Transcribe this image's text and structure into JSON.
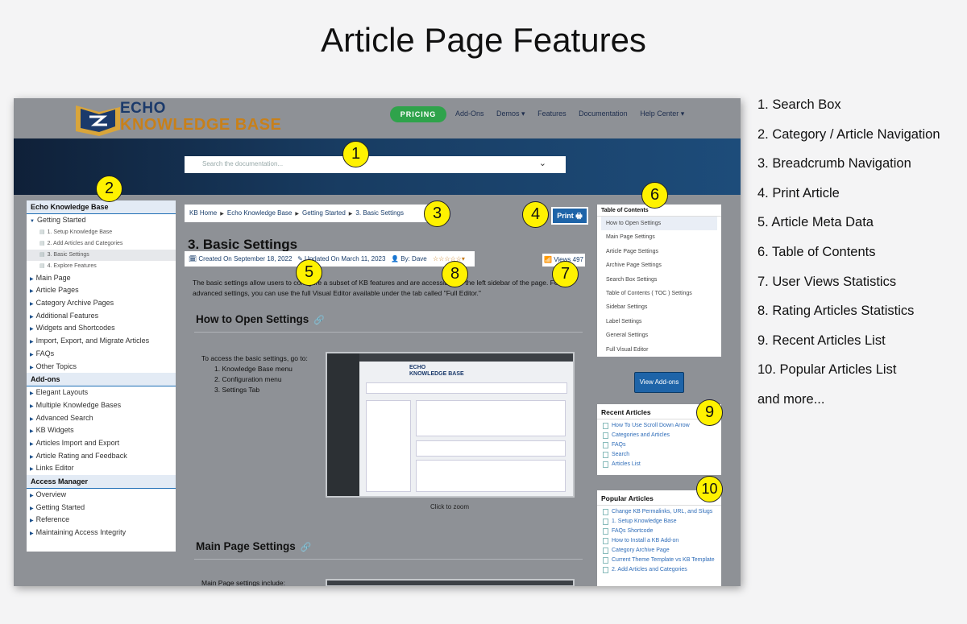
{
  "page_title": "Article Page Features",
  "site": {
    "logo_line1": "ECHO",
    "logo_line2": "KNOWLEDGE BASE",
    "pricing_label": "PRICING",
    "nav": [
      "Add-Ons",
      "Demos ▾",
      "Features",
      "Documentation",
      "Help Center ▾"
    ],
    "search_placeholder": "Search the documentation...",
    "search_chevron": "⌄"
  },
  "sidebar": {
    "title": "Echo Knowledge Base",
    "getting_started": "Getting Started",
    "sub_items": [
      "1. Setup Knowledge Base",
      "2. Add Articles and Categories",
      "3. Basic Settings",
      "4. Explore Features"
    ],
    "items": [
      "Main Page",
      "Article Pages",
      "Category Archive Pages",
      "Additional Features",
      "Widgets and Shortcodes",
      "Import, Export, and Migrate Articles",
      "FAQs",
      "Other Topics"
    ],
    "addons_title": "Add-ons",
    "addons": [
      "Elegant Layouts",
      "Multiple Knowledge Bases",
      "Advanced Search",
      "KB Widgets",
      "Articles Import and Export",
      "Article Rating and Feedback",
      "Links Editor"
    ],
    "access_title": "Access Manager",
    "access": [
      "Overview",
      "Getting Started",
      "Reference",
      "Maintaining Access Integrity"
    ]
  },
  "article": {
    "breadcrumb": [
      "KB Home",
      "Echo Knowledge Base",
      "Getting Started",
      "3. Basic Settings"
    ],
    "print_label": "Print 🖶",
    "title": "3. Basic Settings",
    "created": "🗓 Created On September 18, 2022",
    "updated": "✎ Updated On March 11, 2023",
    "author": "👤 By: Dave",
    "rating_stars": "☆☆☆☆☆▾",
    "views": "📶 Views 497",
    "intro": "The basic settings allow users to configure a subset of KB features and are accessible on the left sidebar of the page. For advanced settings, you can use the full Visual Editor available under the tab called \"Full Editor.\"",
    "section1": "How to Open Settings",
    "link_icon": "🔗",
    "steps_intro": "To access the basic settings, go to:",
    "steps": [
      "1. Knowledge Base menu",
      "2. Configuration menu",
      "3. Settings Tab"
    ],
    "zoom_caption": "Click to zoom",
    "section2": "Main Page Settings",
    "section2_text": "Main Page settings include:"
  },
  "toc": {
    "title": "Table of Contents",
    "items": [
      "How to Open Settings",
      "Main Page Settings",
      "Article Page Settings",
      "Archive Page Settings",
      "Search Box Settings",
      "Table of Contents ( TOC ) Settings",
      "Sidebar Settings",
      "Label Settings",
      "General Settings",
      "Full Visual Editor"
    ]
  },
  "view_addons": "View Add-ons",
  "recent": {
    "title": "Recent Articles",
    "items": [
      "How To Use Scroll Down Arrow",
      "Categories and Articles",
      "FAQs",
      "Search",
      "Articles List"
    ]
  },
  "popular": {
    "title": "Popular Articles",
    "items": [
      "Change KB Permalinks, URL, and Slugs",
      "1. Setup Knowledge Base",
      "FAQs Shortcode",
      "How to Install a KB Add-on",
      "Category Archive Page",
      "Current Theme Template vs KB Template",
      "2. Add Articles and Categories"
    ]
  },
  "badges": [
    "1",
    "2",
    "3",
    "4",
    "5",
    "6",
    "7",
    "8",
    "9",
    "10"
  ],
  "legend": [
    "1. Search Box",
    "2. Category / Article Navigation",
    "3. Breadcrumb Navigation",
    "4. Print Article",
    "5. Article Meta Data",
    "6. Table of Contents",
    "7. User Views Statistics",
    "8. Rating Articles Statistics",
    "9. Recent Articles List",
    "10. Popular Articles List",
    "and more..."
  ],
  "colors": {
    "accent": "#1e64a8",
    "badge": "#fff200",
    "pricing": "#2fa34b",
    "hero": "#183c62"
  }
}
